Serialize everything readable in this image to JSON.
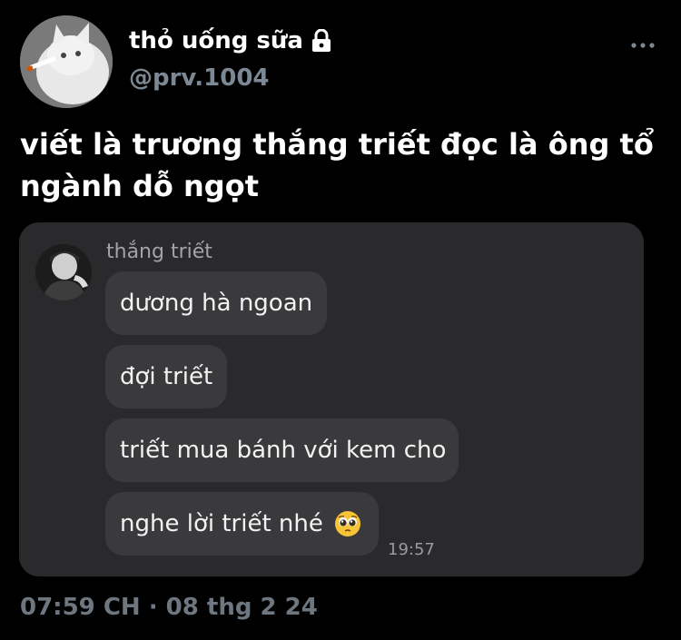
{
  "author": {
    "display_name": "thỏ uống sữa",
    "handle": "@prv.1004",
    "avatar_icon": "cat-avatar-icon",
    "lock_icon": "lock-icon"
  },
  "more_icon": "more-horizontal-icon",
  "tweet": {
    "text": "viết là trương thắng triết đọc là ông tổ ngành dỗ ngọt"
  },
  "media": {
    "sender_name": "thắng triết",
    "sender_avatar_icon": "profile-avatar-icon",
    "messages": [
      {
        "text": "dương hà ngoan"
      },
      {
        "text": "đợi triết"
      },
      {
        "text": "triết mua bánh với kem cho"
      },
      {
        "text": "nghe lời triết nhé",
        "emoji": "pleading-face-emoji-icon"
      }
    ],
    "time": "19:57"
  },
  "footer": {
    "time": "07:59 CH",
    "separator": "·",
    "date": "08 thg 2 24"
  },
  "colors": {
    "background": "#000000",
    "secondary_text": "#7c8893",
    "chat_panel": "#2a2a2c",
    "bubble": "#3a3a3d"
  }
}
